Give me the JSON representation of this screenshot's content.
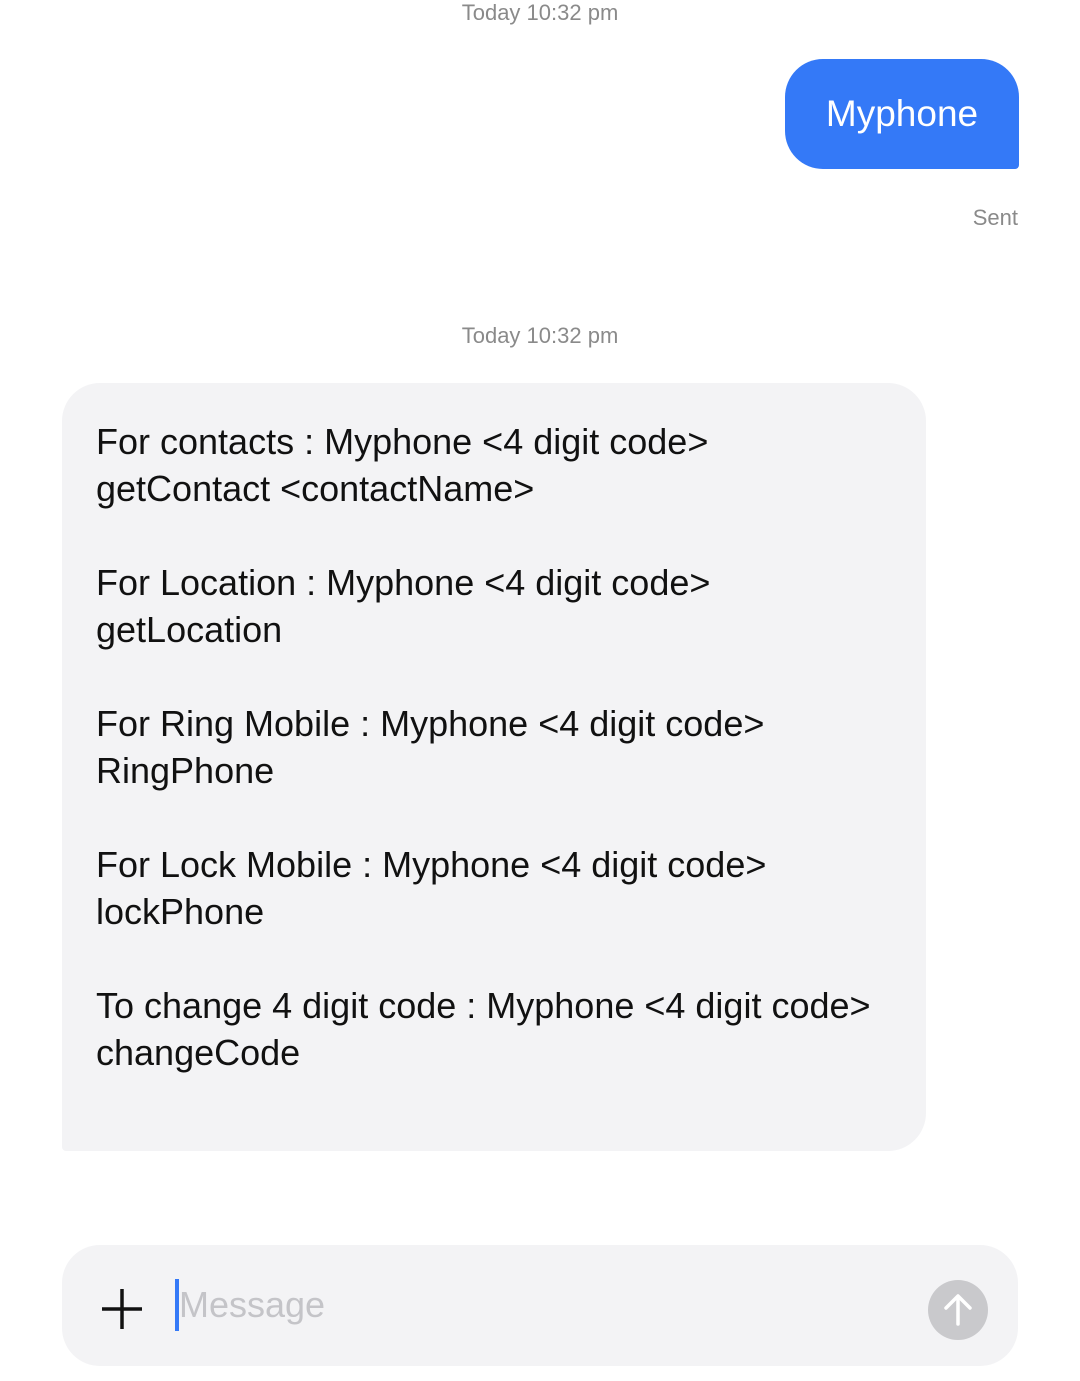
{
  "conversation": {
    "messages": [
      {
        "direction": "outgoing",
        "timestamp": "Today 10:32 pm",
        "text": "Myphone",
        "status": "Sent"
      },
      {
        "direction": "incoming",
        "timestamp": "Today 10:32 pm",
        "paragraphs": [
          "For contacts : Myphone <4 digit code>\ngetContact <contactName>",
          "For Location : Myphone <4 digit code>\ngetLocation",
          "For Ring Mobile : Myphone <4 digit code>\nRingPhone",
          "For Lock Mobile : Myphone <4 digit code>\nlockPhone",
          "To change 4 digit code : Myphone <4 digit code>\nchangeCode"
        ]
      }
    ]
  },
  "composer": {
    "placeholder": "Message",
    "value": "",
    "add_icon": "plus-icon",
    "send_icon": "arrow-up-icon"
  },
  "colors": {
    "sent_bubble": "#3479f7",
    "received_bubble": "#f3f3f5",
    "timestamp_text": "#8a8a8a",
    "send_button_disabled": "#c9c9cc"
  }
}
